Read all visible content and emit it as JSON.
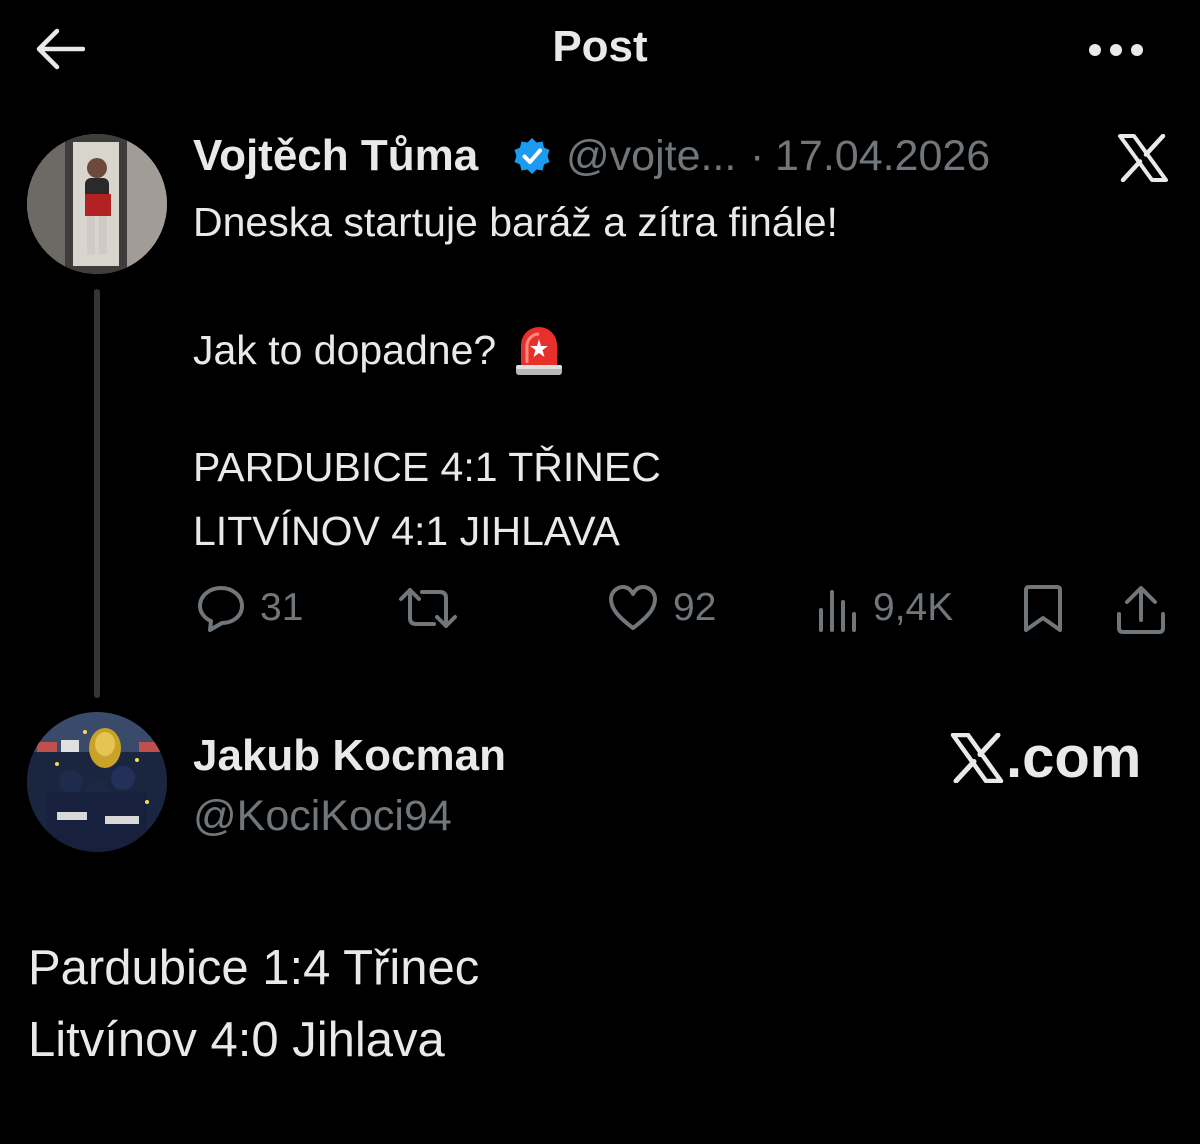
{
  "header": {
    "title": "Post",
    "back_icon": "arrow-left-icon",
    "more_icon": "more-horizontal-icon"
  },
  "tweet": {
    "author_name": "Vojtěch Tůma",
    "verified": true,
    "handle": "@vojte...",
    "separator": "·",
    "date": "17.04.2026",
    "platform_logo": "x-logo-icon",
    "body": [
      "Dneska startuje baráž a zítra finále!",
      "Jak to dopadne?",
      "PARDUBICE 4:1 TŘINEC",
      "LITVÍNOV 4:1 JIHLAVA"
    ],
    "emoji": "rotating-light-siren-icon",
    "actions": {
      "replies": "31",
      "reposts": "",
      "likes": "92",
      "views": "9,4K"
    }
  },
  "reply": {
    "author_name": "Jakub Kocman",
    "handle": "@KociKoci94",
    "watermark": ".com",
    "body": [
      "Pardubice 1:4 Třinec",
      "Litvínov 4:0 Jihlava"
    ]
  },
  "colors": {
    "background": "#000000",
    "primary_text": "#e7e9ea",
    "secondary_text": "#71767b",
    "verified_blue": "#1d9bf0",
    "thread_line": "#333639"
  }
}
